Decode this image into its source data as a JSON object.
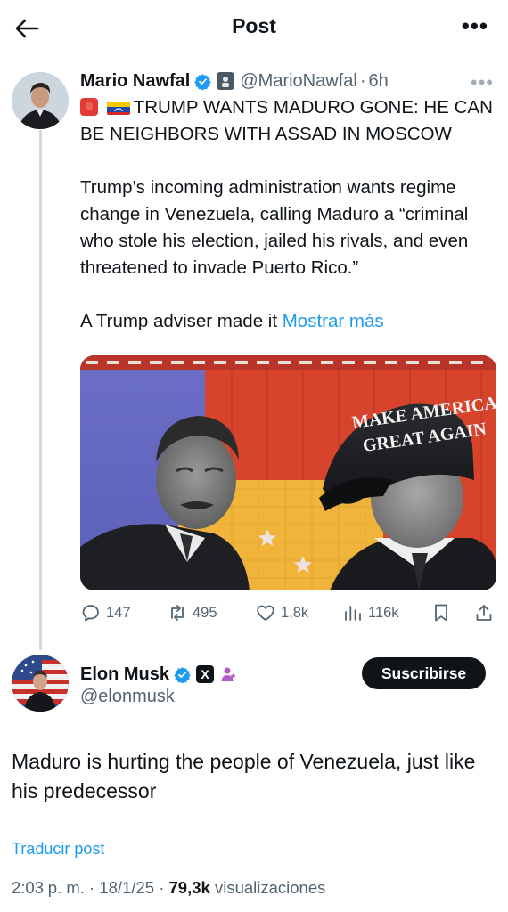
{
  "header": {
    "title": "Post",
    "back_icon": "arrow-left-icon",
    "more_icon": "more-horizontal-icon"
  },
  "tweet1": {
    "author_name": "Mario Nawfal",
    "handle": "@MarioNawfal",
    "separator": "·",
    "time": "6h",
    "headline": "TRUMP WANTS MADURO GONE: HE CAN BE NEIGHBORS WITH ASSAD IN MOSCOW",
    "paragraph": "Trump’s incoming administration wants regime change in Venezuela, calling Maduro a “criminal who stole his election, jailed his rivals, and even threatened to invade Puerto Rico.”",
    "teaser": "A Trump adviser made it ",
    "show_more": "Mostrar más",
    "image_hat_line1": "MAKE AMERICA",
    "image_hat_line2": "GREAT AGAIN",
    "stats": {
      "replies": "147",
      "reposts": "495",
      "likes": "1,8k",
      "views": "116k"
    }
  },
  "tweet2": {
    "author_name": "Elon Musk",
    "handle": "@elonmusk",
    "affiliate_badge": "X",
    "subscribe_label": "Suscribirse",
    "text": "Maduro is hurting the people of Venezuela, just like his predecessor",
    "translate_label": "Traducir post",
    "time": "2:03",
    "ampm": "p. m.",
    "date": "18/1/25",
    "dot": "·",
    "views_count": "79,3k",
    "views_label": "visualizaciones"
  },
  "colors": {
    "accent": "#1d9bf0",
    "text": "#0f1419",
    "secondary": "#536471",
    "line": "#cfd9de"
  }
}
